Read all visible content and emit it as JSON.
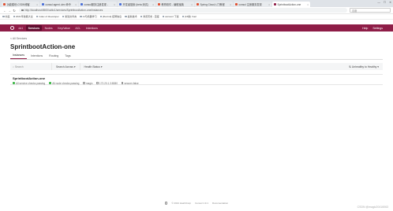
{
  "browser": {
    "tabs": [
      {
        "label": "功能模块-CSDN博客",
        "color": "#e04f2f"
      },
      {
        "label": "consul agent -dev 命令",
        "color": "#4a6fd8"
      },
      {
        "label": "consul服务注册发现 - ",
        "color": "#4a6fd8"
      },
      {
        "label": "开发者搜索 (beta 测试)",
        "color": "#4a6fd8"
      },
      {
        "label": "教育软件 - 编程宝典",
        "color": "#e04f2f"
      },
      {
        "label": "Spring Cloud入门教程",
        "color": "#e04f2f"
      },
      {
        "label": "consul 注册服务发现",
        "color": "#e04f2f"
      },
      {
        "label": "SprintbootAction-one",
        "color": "#8e1d47"
      }
    ],
    "url": "http://localhost:8500/ui/dc1/services/SprintbootAction-one/instances",
    "search_placeholder": "百度",
    "bookmarks": [
      "书签",
      "2021年技能大全",
      "Index of /developer",
      "新建文件夹",
      "AI与机器学习",
      "[Recruit] 招聘信息",
      "最新技术",
      "浏览历史 - 百度",
      "account 下载",
      "[16新] Vuel"
    ]
  },
  "consul": {
    "nav": {
      "dc": "dc1",
      "items": [
        "Services",
        "Nodes",
        "Key/Value",
        "ACL",
        "Intentions"
      ],
      "active": "Services",
      "help": "Help",
      "settings": "Settings"
    },
    "breadcrumb": "< All Services",
    "title": "SprintbootAction-one",
    "tabs": [
      "Instances",
      "Intentions",
      "Routing",
      "Tags"
    ],
    "active_tab": "Instances",
    "filter": {
      "search_placeholder": "Search",
      "search_across": "Search Across",
      "health": "Health Status",
      "sort": "Unhealthy to Healthy"
    },
    "instance": {
      "name": "SprintbootAction-one",
      "service_checks": "All service checks passing",
      "node_checks": "All node checks passing",
      "node": "magic",
      "address": "172.20.1.3:8080",
      "tag": "secure=false"
    }
  },
  "footer": {
    "copyright": "© 2021 HashiCorp",
    "version": "Consul 1.9.1",
    "docs": "Documentation"
  },
  "watermark": "CSDN @magic20416063"
}
